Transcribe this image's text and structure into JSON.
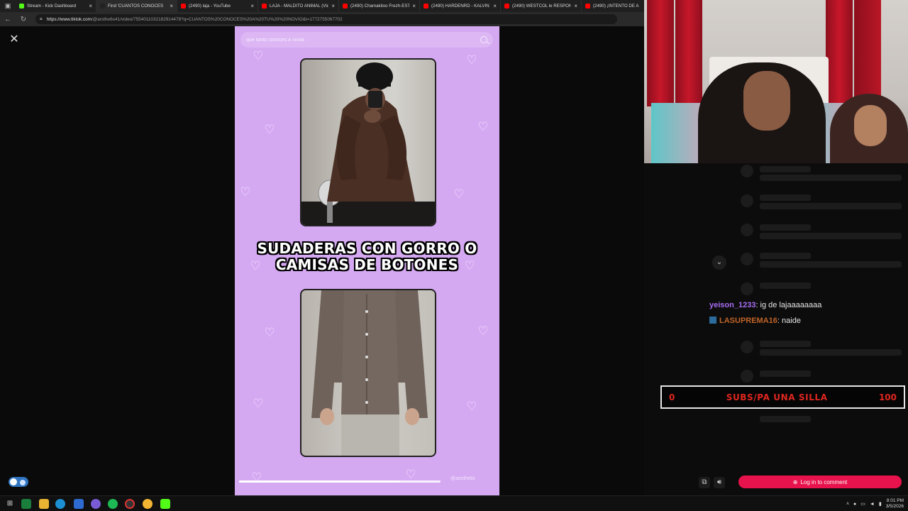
{
  "browser": {
    "tabs": [
      {
        "label": "Stream - Kick Dashboard",
        "color": "#53fc18",
        "active": false
      },
      {
        "label": "Find 'CUANTOS CONOCES",
        "color": "#222222",
        "active": true
      },
      {
        "label": "(2490) laja - YouTube",
        "color": "#ff0000",
        "active": false
      },
      {
        "label": "LAJA - MALDITO ANIMAL (Vide",
        "color": "#ff0000",
        "active": false
      },
      {
        "label": "(2490) Chamakitoo Frezh-ESTU",
        "color": "#ff0000",
        "active": false
      },
      {
        "label": "(2490) HARDENRD - KALVIN KL",
        "color": "#ff0000",
        "active": false
      },
      {
        "label": "(2490) WESTCOL le RESPONDE",
        "color": "#ff0000",
        "active": false
      },
      {
        "label": "(2490) ¡INTENTO DE A",
        "color": "#ff0000",
        "active": false
      }
    ],
    "url_host": "https://www.tiktok.com",
    "url_path": "/@arsthe6o41/video/7554011032182914478?q=CUANTOS%20CONOCES%20A%20TU%20%20NOVIO&t=1772755067702"
  },
  "video": {
    "search_query": "que tanto conoces a novia",
    "caption_line1": "SUDADERAS CON GORRO O",
    "caption_line2": "CAMISAS DE BOTONES",
    "watermark": "@aesthetic",
    "progress": 0.8
  },
  "chat": {
    "messages": [
      {
        "user": "yeison_1233",
        "text": ": ig de lajaaaaaaaa"
      },
      {
        "user": "LASUPREMA16",
        "text": ": naide"
      }
    ],
    "goal": {
      "start": "0",
      "label": "SUBS/PA UNA SILLA",
      "end": "100"
    },
    "login_label": "Log in to comment"
  },
  "taskbar": {
    "time": "8:01 PM",
    "date": "3/5/2026"
  },
  "colors": {
    "video_bg": "#d5a8f2",
    "kick_green": "#53fc18",
    "login_pink": "#e8124c",
    "goal_red": "#e0261f"
  }
}
